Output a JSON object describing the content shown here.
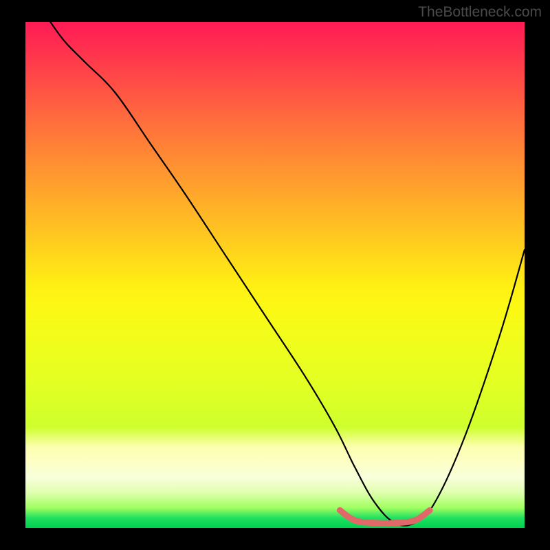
{
  "watermark": "TheBottleneck.com",
  "chart_data": {
    "type": "line",
    "title": "",
    "xlabel": "",
    "ylabel": "",
    "xlim": [
      0,
      100
    ],
    "ylim": [
      0,
      100
    ],
    "grid": false,
    "series": [
      {
        "name": "curve",
        "color": "#000000",
        "x": [
          5,
          8,
          12,
          18,
          25,
          32,
          40,
          48,
          56,
          62,
          66,
          70,
          74,
          78,
          82,
          88,
          95,
          100
        ],
        "y": [
          100,
          96,
          92,
          86,
          76,
          66,
          54,
          42,
          30,
          20,
          12,
          5,
          1,
          1,
          5,
          18,
          38,
          55
        ]
      }
    ],
    "highlight_segment": {
      "name": "optimal-range",
      "color": "#e06868",
      "x": [
        63,
        66,
        70,
        74,
        78,
        81
      ],
      "y": [
        3.5,
        1.5,
        1,
        1,
        1.5,
        3.5
      ]
    },
    "gradient_stops": [
      {
        "pos": 0,
        "color": "#ff1a55"
      },
      {
        "pos": 50,
        "color": "#ffef14"
      },
      {
        "pos": 85,
        "color": "#fdffc5"
      },
      {
        "pos": 100,
        "color": "#00d050"
      }
    ]
  }
}
